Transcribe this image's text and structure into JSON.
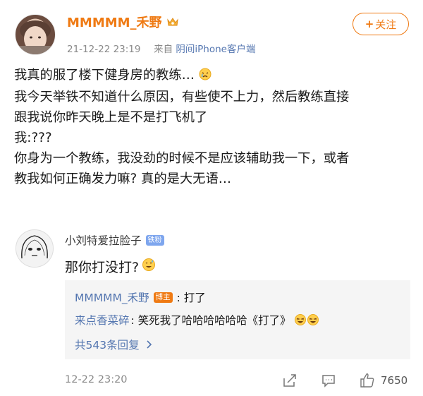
{
  "post": {
    "username": "MMMMM_禾野",
    "time": "21-12-22 23:19",
    "source_prefix": "来自",
    "source": "阴间iPhone客户端",
    "follow_label": "关注",
    "lines": [
      "我真的服了楼下健身房的教练…",
      "我今天举铁不知道什么原因，有些使不上力，然后教练直接",
      "跟我说你昨天晚上是不是打飞机了",
      "我:???",
      "你身为一个教练，我没劲的时候不是应该辅助我一下，或者",
      "教我如何正确发力嘛? 真的是大无语…"
    ]
  },
  "comment": {
    "username": "小刘特爱拉脸子",
    "fan_badge": "铁粉",
    "text": "那你打没打?",
    "time": "12-22 23:20",
    "like_count": "7650",
    "replies": [
      {
        "name": "MMMMM_禾野",
        "badge": "博主",
        "text": ": 打了"
      },
      {
        "name": "来点香菜碎",
        "badge": "",
        "text": ": 笑死我了哈哈哈哈哈哈《打了》"
      }
    ],
    "more_replies": "共543条回复"
  },
  "colors": {
    "accent": "#ef7a13",
    "link": "#5476b0",
    "meta": "#8a8a8a"
  },
  "icons": [
    "crown-badge-icon",
    "crying-emoji-icon",
    "sweat-smile-emoji-icon",
    "laugh-emoji-icon",
    "chevron-right-icon",
    "share-icon",
    "comment-icon",
    "like-icon"
  ]
}
